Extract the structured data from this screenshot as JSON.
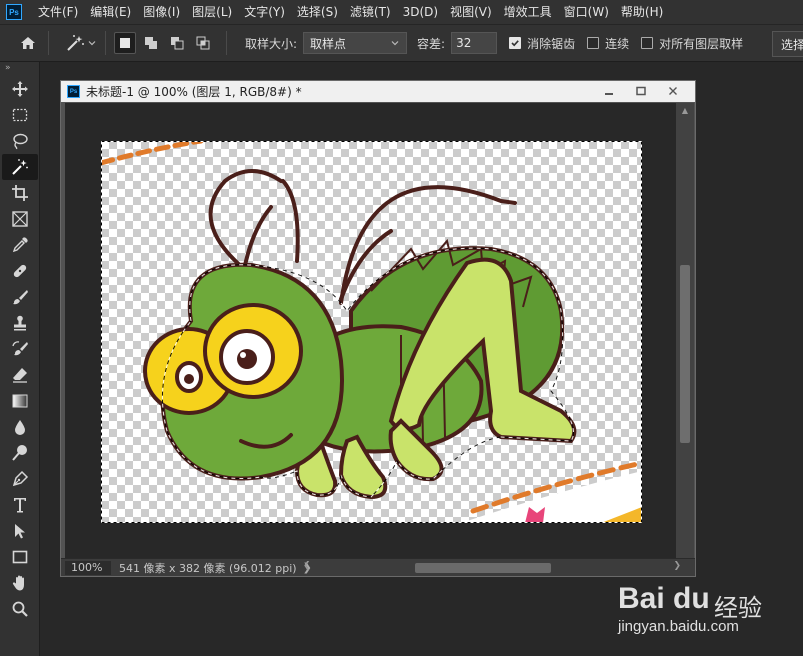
{
  "app": {
    "logo_text": "Ps"
  },
  "menu": {
    "items": [
      "文件(F)",
      "编辑(E)",
      "图像(I)",
      "图层(L)",
      "文字(Y)",
      "选择(S)",
      "滤镜(T)",
      "3D(D)",
      "视图(V)",
      "增效工具",
      "窗口(W)",
      "帮助(H)"
    ]
  },
  "options": {
    "sample_size_label": "取样大小:",
    "sample_size_value": "取样点",
    "tolerance_label": "容差:",
    "tolerance_value": "32",
    "antialias_label": "消除锯齿",
    "antialias_checked": true,
    "contiguous_label": "连续",
    "contiguous_checked": false,
    "all_layers_label": "对所有图层取样",
    "all_layers_checked": false,
    "select_subject_label": "选择主体"
  },
  "toolbar": {
    "collapse": "»",
    "active_tool": "magic-wand-icon"
  },
  "document": {
    "title": "未标题-1 @ 100% (图层 1, RGB/8#) *",
    "zoom": "100%",
    "info": "541 像素 x 382 像素 (96.012 ppi)",
    "caret": "❯"
  },
  "watermark": {
    "logo": "Bai du",
    "product": "经验",
    "url": "jingyan.baidu.com"
  },
  "colors": {
    "ui_bg": "#323232",
    "workspace": "#282828",
    "grasshopper_green": "#6ea93a",
    "leg_light": "#c9e36a",
    "eye_yellow": "#f6d21c",
    "outline": "#4a1f1a",
    "dash_orange": "#e07a2a"
  }
}
